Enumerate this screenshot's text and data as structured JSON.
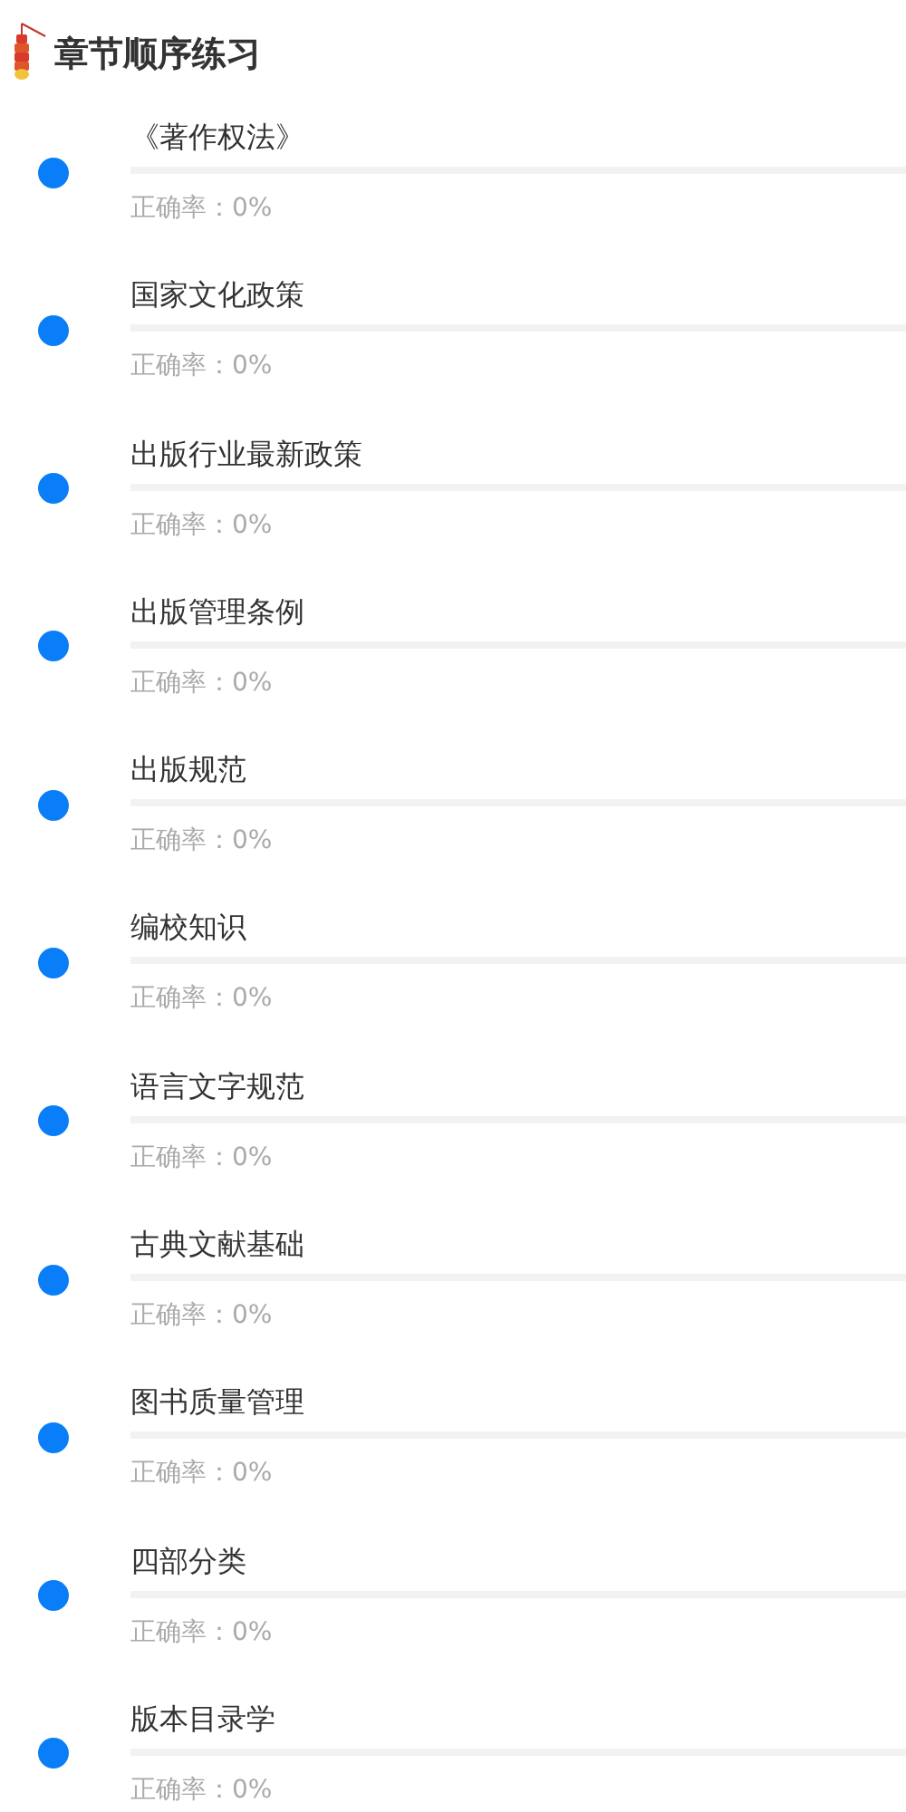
{
  "header": {
    "title": "章节顺序练习"
  },
  "chapters": [
    {
      "title": "《著作权法》",
      "level": 0,
      "accuracy": "正确率：0%"
    },
    {
      "title": "国家文化政策",
      "level": 0,
      "accuracy": "正确率：0%"
    },
    {
      "title": "出版行业最新政策",
      "level": 0,
      "accuracy": "正确率：0%"
    },
    {
      "title": "出版管理条例",
      "level": 0,
      "accuracy": "正确率：0%"
    },
    {
      "title": "出版规范",
      "level": 0,
      "accuracy": "正确率：0%"
    },
    {
      "title": "编校知识",
      "level": 0,
      "accuracy": "正确率：0%"
    },
    {
      "title": "语言文字规范",
      "level": 0,
      "accuracy": "正确率：0%"
    },
    {
      "title": "古典文献基础",
      "level": 0,
      "accuracy": "正确率：0%"
    },
    {
      "title": "图书质量管理",
      "level": 0,
      "accuracy": "正确率：0%"
    },
    {
      "title": "四部分类",
      "level": 0,
      "accuracy": "正确率：0%"
    },
    {
      "title": "版本目录学",
      "level": 0,
      "accuracy": "正确率：0%"
    }
  ]
}
